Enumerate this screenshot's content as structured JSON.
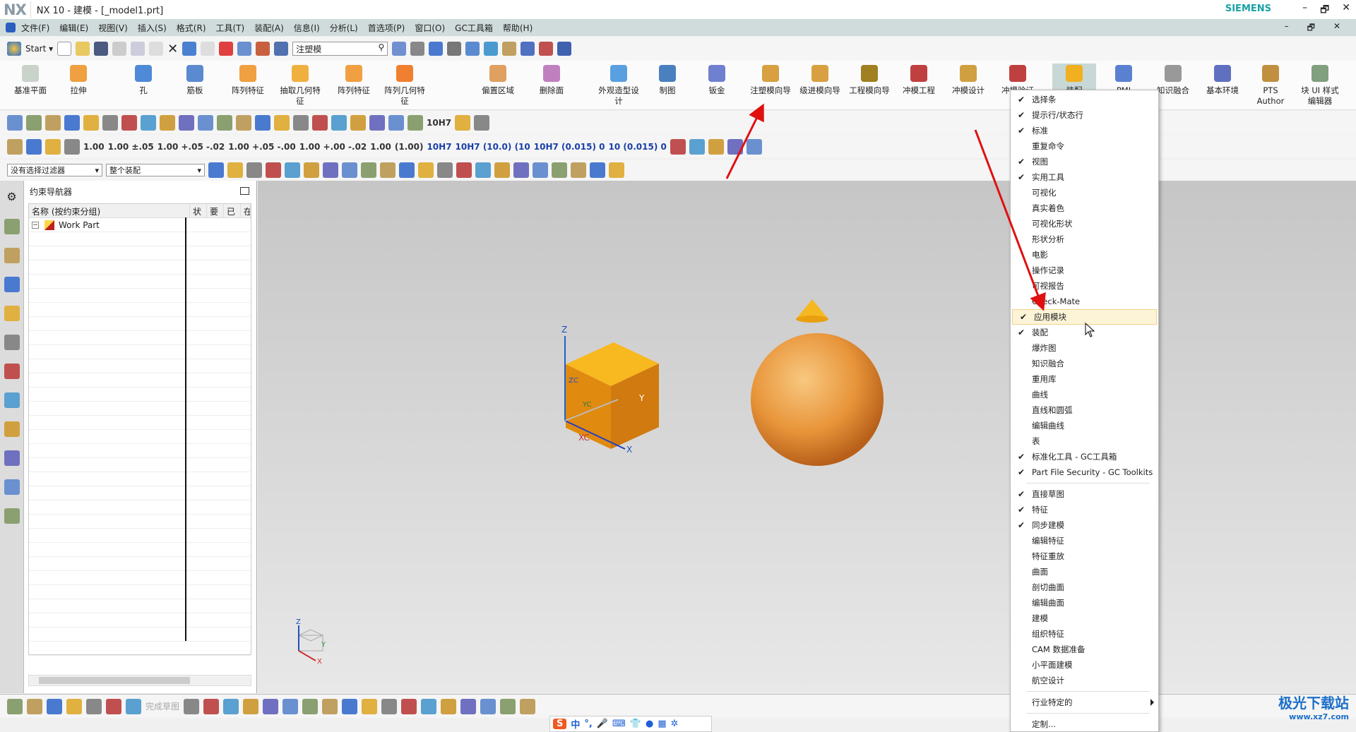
{
  "window": {
    "logo": "NX",
    "title": "NX 10 - 建模 - [_model1.prt]",
    "brand": "SIEMENS",
    "controls": [
      "–",
      "🗗",
      "✕"
    ]
  },
  "menubar": [
    "文件(F)",
    "编辑(E)",
    "视图(V)",
    "插入(S)",
    "格式(R)",
    "工具(T)",
    "装配(A)",
    "信息(I)",
    "分析(L)",
    "首选项(P)",
    "窗口(O)",
    "GC工具箱",
    "帮助(H)"
  ],
  "standard": {
    "start": "Start ▾",
    "search_value": "注塑模"
  },
  "ribbon": [
    {
      "label": "基准平面",
      "color": "#c9d3c9"
    },
    {
      "label": "拉伸",
      "color": "#f0a040"
    },
    {
      "label": "孔",
      "color": "#4f8ad8"
    },
    {
      "label": "筋板",
      "color": "#5a8ad0"
    },
    {
      "label": "阵列特征",
      "color": "#f0a040"
    },
    {
      "label": "抽取几何特征",
      "color": "#f0b040"
    },
    {
      "label": "阵列特征",
      "color": "#f0a040"
    },
    {
      "label": "阵列几何特征",
      "color": "#f08030"
    },
    {
      "label": "偏置区域",
      "color": "#e0a060"
    },
    {
      "label": "删除面",
      "color": "#c080c0"
    },
    {
      "label": "外观造型设计",
      "color": "#5aa0e0"
    },
    {
      "label": "制图",
      "color": "#4a80c0"
    },
    {
      "label": "钣金",
      "color": "#7080d0"
    },
    {
      "label": "注塑模向导",
      "color": "#d8a040"
    },
    {
      "label": "级进模向导",
      "color": "#d8a040"
    },
    {
      "label": "工程模向导",
      "color": "#a08020"
    },
    {
      "label": "冲模工程",
      "color": "#c04040"
    },
    {
      "label": "冲模设计",
      "color": "#d0a040"
    },
    {
      "label": "冲模验证",
      "color": "#c04040"
    },
    {
      "label": "装配",
      "color": "#f0b020"
    },
    {
      "label": "PMI",
      "color": "#5a80d0"
    },
    {
      "label": "知识融合",
      "color": "#999999"
    },
    {
      "label": "基本环境",
      "color": "#6070c0"
    },
    {
      "label": "PTS Author",
      "color": "#c09040"
    },
    {
      "label": "块 UI 样式编辑器",
      "color": "#80a080"
    }
  ],
  "dims": [
    "1.00",
    "1.00 ±.05",
    "1.00 +.05 -.02",
    "1.00 +.05 -.00",
    "1.00 +.00 -.02",
    "1.00",
    "(1.00)",
    "10H7",
    "10H7 (10.0) (10",
    "10H7 (0.015) 0",
    "10 (0.015) 0"
  ],
  "tolerance_label": "10H7",
  "selection": {
    "filter": "没有选择过滤器",
    "scope": "整个装配"
  },
  "navigator": {
    "title": "约束导航器",
    "columns": [
      "名称 (按约束分组)",
      "状",
      "要",
      "已",
      "在"
    ],
    "rows": [
      {
        "expander": "−",
        "name": "Work Part"
      }
    ]
  },
  "bottombar": {
    "finish_sketch": "完成草图"
  },
  "ime": {
    "logo": "S",
    "items": [
      "中",
      "°,",
      "🎤",
      "⌨",
      "👕",
      "●",
      "▦",
      "✲"
    ]
  },
  "watermark": {
    "text": "极光下载站",
    "url": "www.xz7.com"
  },
  "viewport": {
    "axes": {
      "z": "Z",
      "x": "X",
      "y": "Y",
      "xc": "XC",
      "yc": "YC",
      "zc": "ZC"
    },
    "triad": {
      "z": "Z",
      "x": "X",
      "y": "Y"
    }
  },
  "context_menu": {
    "items": [
      {
        "label": "选择条",
        "checked": true
      },
      {
        "label": "提示行/状态行",
        "checked": true
      },
      {
        "label": "标准",
        "checked": true
      },
      {
        "label": "重复命令",
        "checked": false
      },
      {
        "label": "视图",
        "checked": true
      },
      {
        "label": "实用工具",
        "checked": true
      },
      {
        "label": "可视化",
        "checked": false
      },
      {
        "label": "真实着色",
        "checked": false
      },
      {
        "label": "可视化形状",
        "checked": false
      },
      {
        "label": "形状分析",
        "checked": false
      },
      {
        "label": "电影",
        "checked": false
      },
      {
        "label": "操作记录",
        "checked": false
      },
      {
        "label": "可视报告",
        "checked": false
      },
      {
        "label": "Check-Mate",
        "checked": false
      },
      {
        "label": "应用模块",
        "checked": true,
        "highlighted": true
      },
      {
        "label": "装配",
        "checked": true
      },
      {
        "label": "爆炸图",
        "checked": false
      },
      {
        "label": "知识融合",
        "checked": false
      },
      {
        "label": "重用库",
        "checked": false
      },
      {
        "label": "曲线",
        "checked": false
      },
      {
        "label": "直线和圆弧",
        "checked": false
      },
      {
        "label": "编辑曲线",
        "checked": false
      },
      {
        "label": "表",
        "checked": false
      },
      {
        "label": "标准化工具 - GC工具箱",
        "checked": true
      },
      {
        "label": "Part File Security - GC Toolkits",
        "checked": true
      },
      {
        "separator": true
      },
      {
        "label": "直接草图",
        "checked": true
      },
      {
        "label": "特征",
        "checked": true
      },
      {
        "label": "同步建模",
        "checked": true
      },
      {
        "label": "编辑特征",
        "checked": false
      },
      {
        "label": "特征重放",
        "checked": false
      },
      {
        "label": "曲面",
        "checked": false
      },
      {
        "label": "剖切曲面",
        "checked": false
      },
      {
        "label": "编辑曲面",
        "checked": false
      },
      {
        "label": "建模",
        "checked": false
      },
      {
        "label": "组织特征",
        "checked": false
      },
      {
        "label": "CAM 数据准备",
        "checked": false
      },
      {
        "label": "小平面建模",
        "checked": false
      },
      {
        "label": "航空设计",
        "checked": false
      },
      {
        "separator": true
      },
      {
        "label": "行业特定的",
        "checked": false,
        "submenu": true
      },
      {
        "separator": true
      },
      {
        "label": "定制...",
        "checked": false
      }
    ]
  },
  "colors": {
    "accent": "#19a1a5",
    "menubar": "#cfdcdb",
    "part": "#f0a020",
    "annotation": "#e01010",
    "highlight": "#fdf4d8"
  }
}
